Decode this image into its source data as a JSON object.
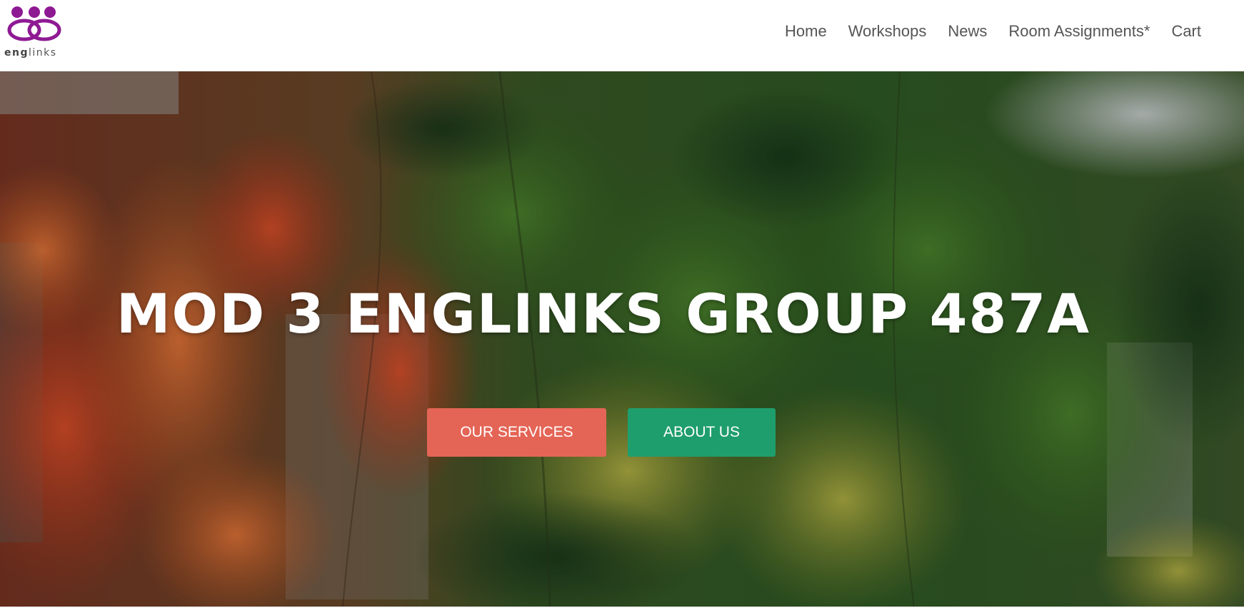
{
  "header": {
    "logo_text_bold": "eng",
    "logo_text_rest": "links",
    "logo_color": "#8e1a93"
  },
  "nav": {
    "items": [
      {
        "label": "Home"
      },
      {
        "label": "Workshops"
      },
      {
        "label": "News"
      },
      {
        "label": "Room Assignments*"
      },
      {
        "label": "Cart"
      }
    ]
  },
  "hero": {
    "title": "MOD 3 ENGLINKS GROUP 487A",
    "primary_button": {
      "label": "OUR SERVICES",
      "color": "#e46556"
    },
    "secondary_button": {
      "label": "ABOUT US",
      "color": "#1f9e6d"
    }
  }
}
